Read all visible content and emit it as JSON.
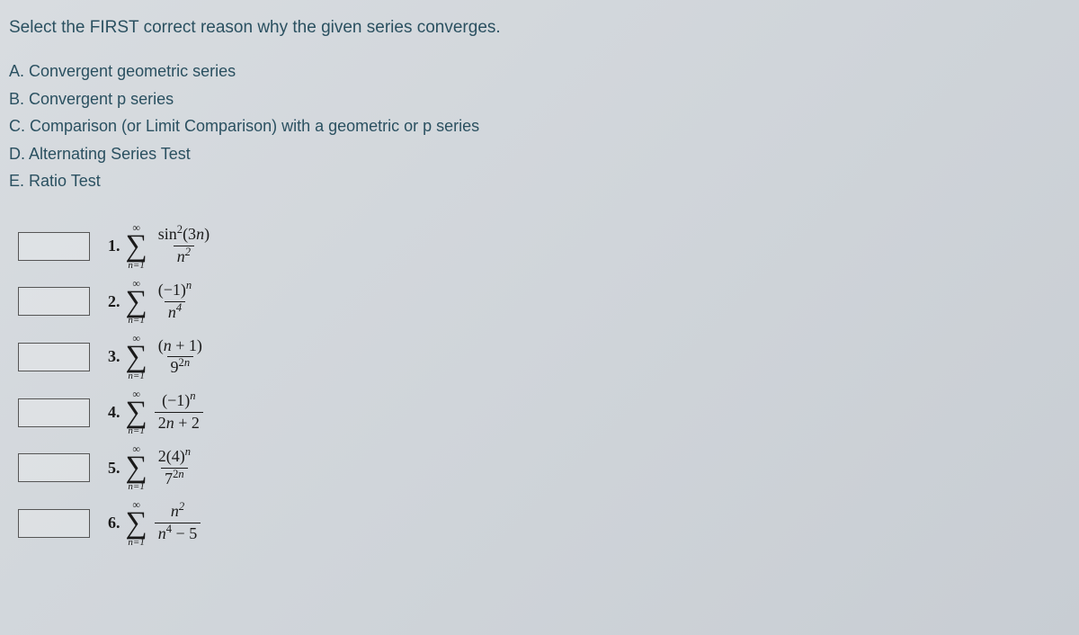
{
  "instruction": "Select the FIRST correct reason why the given series converges.",
  "options": {
    "A": "A. Convergent geometric series",
    "B": "B. Convergent p series",
    "C": "C. Comparison (or Limit Comparison) with a geometric or p series",
    "D": "D. Alternating Series Test",
    "E": "E. Ratio Test"
  },
  "sigma": {
    "top": "∞",
    "bottom": "n=1"
  },
  "problems": {
    "p1": {
      "num": "1.",
      "top": "sin²(3n)",
      "bottom": "n²"
    },
    "p2": {
      "num": "2.",
      "top": "(−1)ⁿ",
      "bottom": "n⁴"
    },
    "p3": {
      "num": "3.",
      "top": "(n + 1)",
      "bottom": "9²ⁿ"
    },
    "p4": {
      "num": "4.",
      "top": "(−1)ⁿ",
      "bottom": "2n + 2"
    },
    "p5": {
      "num": "5.",
      "top": "2(4)ⁿ",
      "bottom": "7²ⁿ"
    },
    "p6": {
      "num": "6.",
      "top": "n²",
      "bottom": "n⁴ − 5"
    }
  }
}
